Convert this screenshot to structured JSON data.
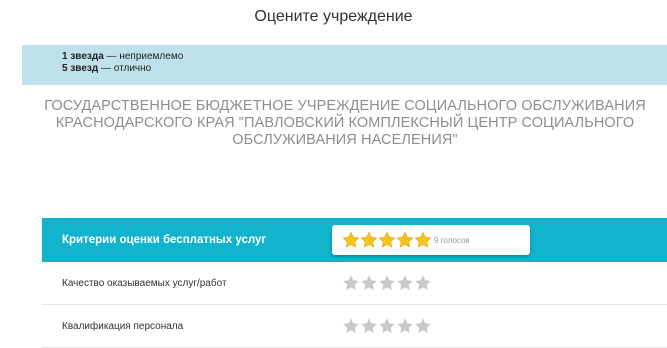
{
  "page": {
    "title": "Оцените учреждение"
  },
  "legend": {
    "line1_bold": "1 звезда",
    "line1_rest": " — неприемлемо",
    "line2_bold": "5 звезд",
    "line2_rest": " — отлично"
  },
  "organization": {
    "name": "Государственное бюджетное учреждение социального обслуживания Краснодарского края \"Павловский комплексный центр социального обслуживания населения\""
  },
  "criteria": {
    "header": {
      "label": "Критерии оценки бесплатных услуг",
      "rating": 5,
      "max": 5,
      "votes": "9 голосов"
    },
    "rows": [
      {
        "label": "Качество оказываемых услуг/работ",
        "rating": 0,
        "max": 5
      },
      {
        "label": "Квалификация персонала",
        "rating": 0,
        "max": 5
      }
    ]
  },
  "colors": {
    "star_filled": "#f6c31a",
    "star_empty": "#c9c9c9",
    "header_bg": "#12b3cc",
    "legend_bg": "#bfe2ea"
  },
  "icons": {
    "star": "star-icon"
  }
}
